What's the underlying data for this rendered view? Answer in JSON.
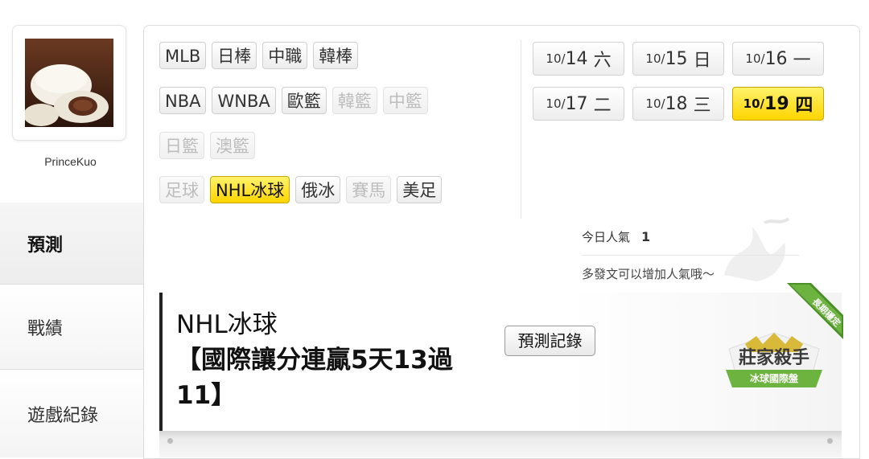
{
  "user": {
    "name": "PrinceKuo"
  },
  "nav": [
    {
      "label": "預測",
      "active": true
    },
    {
      "label": "戰績",
      "active": false
    },
    {
      "label": "遊戲紀錄",
      "active": false
    }
  ],
  "categories": [
    [
      {
        "label": "MLB",
        "state": "normal"
      },
      {
        "label": "日棒",
        "state": "normal"
      },
      {
        "label": "中職",
        "state": "normal"
      },
      {
        "label": "韓棒",
        "state": "normal"
      }
    ],
    [
      {
        "label": "NBA",
        "state": "normal"
      },
      {
        "label": "WNBA",
        "state": "normal"
      },
      {
        "label": "歐籃",
        "state": "normal"
      },
      {
        "label": "韓籃",
        "state": "disabled"
      },
      {
        "label": "中籃",
        "state": "disabled"
      }
    ],
    [
      {
        "label": "日籃",
        "state": "disabled"
      },
      {
        "label": "澳籃",
        "state": "disabled"
      }
    ],
    [
      {
        "label": "足球",
        "state": "disabled"
      },
      {
        "label": "NHL冰球",
        "state": "active"
      },
      {
        "label": "俄冰",
        "state": "normal"
      },
      {
        "label": "賽馬",
        "state": "disabled"
      },
      {
        "label": "美足",
        "state": "normal"
      }
    ]
  ],
  "dates": [
    {
      "month": "10/",
      "day": "14",
      "weekday": "六",
      "active": false
    },
    {
      "month": "10/",
      "day": "15",
      "weekday": "日",
      "active": false
    },
    {
      "month": "10/",
      "day": "16",
      "weekday": "一",
      "active": false
    },
    {
      "month": "10/",
      "day": "17",
      "weekday": "二",
      "active": false
    },
    {
      "month": "10/",
      "day": "18",
      "weekday": "三",
      "active": false
    },
    {
      "month": "10/",
      "day": "19",
      "weekday": "四",
      "active": true
    }
  ],
  "popularity": {
    "label": "今日人氣",
    "value": "1",
    "hint": "多發文可以增加人氣哦～"
  },
  "post": {
    "category": "NHL冰球",
    "title_line1": "【國際讓分連贏5天13過",
    "title_line2": "11】",
    "record_button": "預測記錄"
  },
  "badge": {
    "title": "莊家殺手",
    "subtitle": "冰球國際盤",
    "ribbon": "長期穩定"
  },
  "colors": {
    "active_yellow": "#ffd500",
    "badge_green": "#6db33f"
  }
}
